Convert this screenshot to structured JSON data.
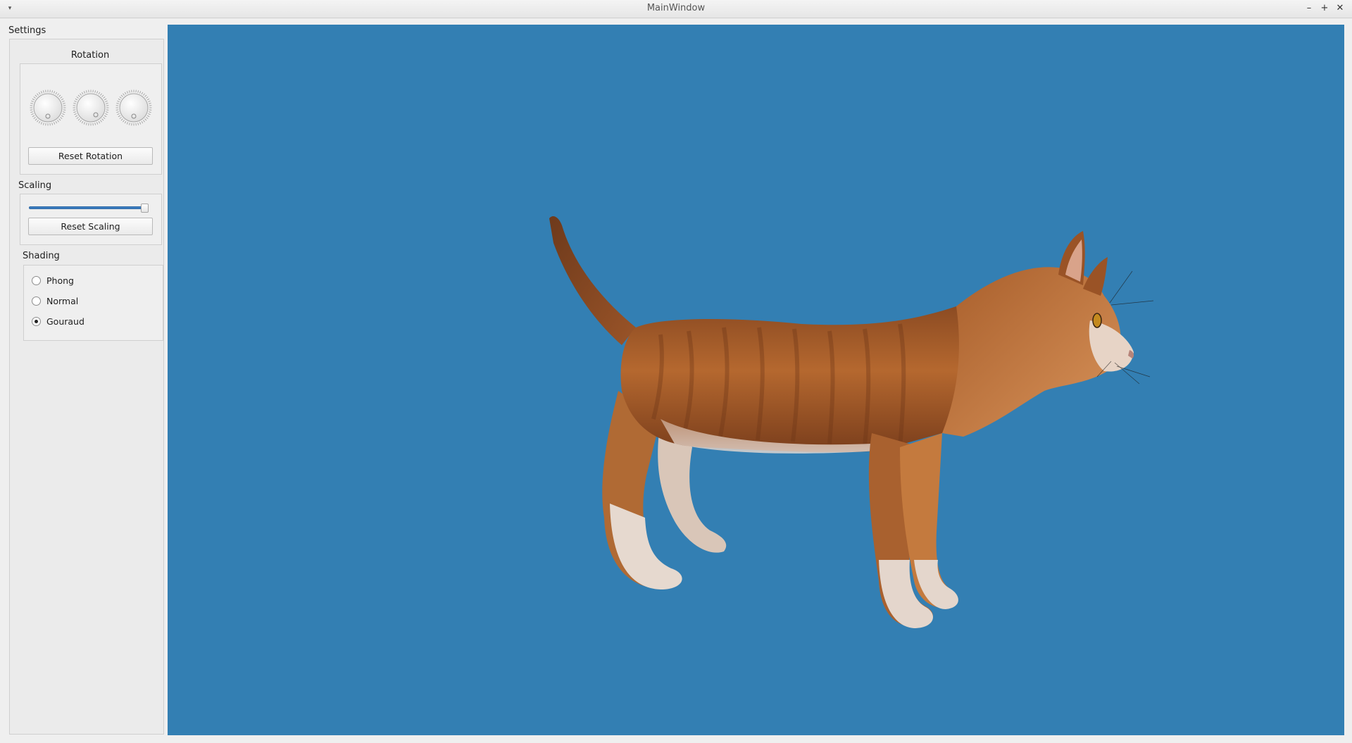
{
  "window": {
    "title": "MainWindow",
    "menu_icon": "chevron-down-icon",
    "minimize_icon": "minimize-icon",
    "maximize_icon": "maximize-icon",
    "close_icon": "close-icon"
  },
  "settings": {
    "label": "Settings",
    "rotation": {
      "title": "Rotation",
      "dial_count": 3,
      "reset_label": "Reset Rotation"
    },
    "scaling": {
      "title": "Scaling",
      "slider_value": 1.0,
      "reset_label": "Reset Scaling"
    },
    "shading": {
      "title": "Shading",
      "options": [
        {
          "label": "Phong",
          "checked": false
        },
        {
          "label": "Normal",
          "checked": false
        },
        {
          "label": "Gouraud",
          "checked": true
        }
      ]
    }
  },
  "viewport": {
    "background": "#337fb3",
    "model": "cat"
  }
}
